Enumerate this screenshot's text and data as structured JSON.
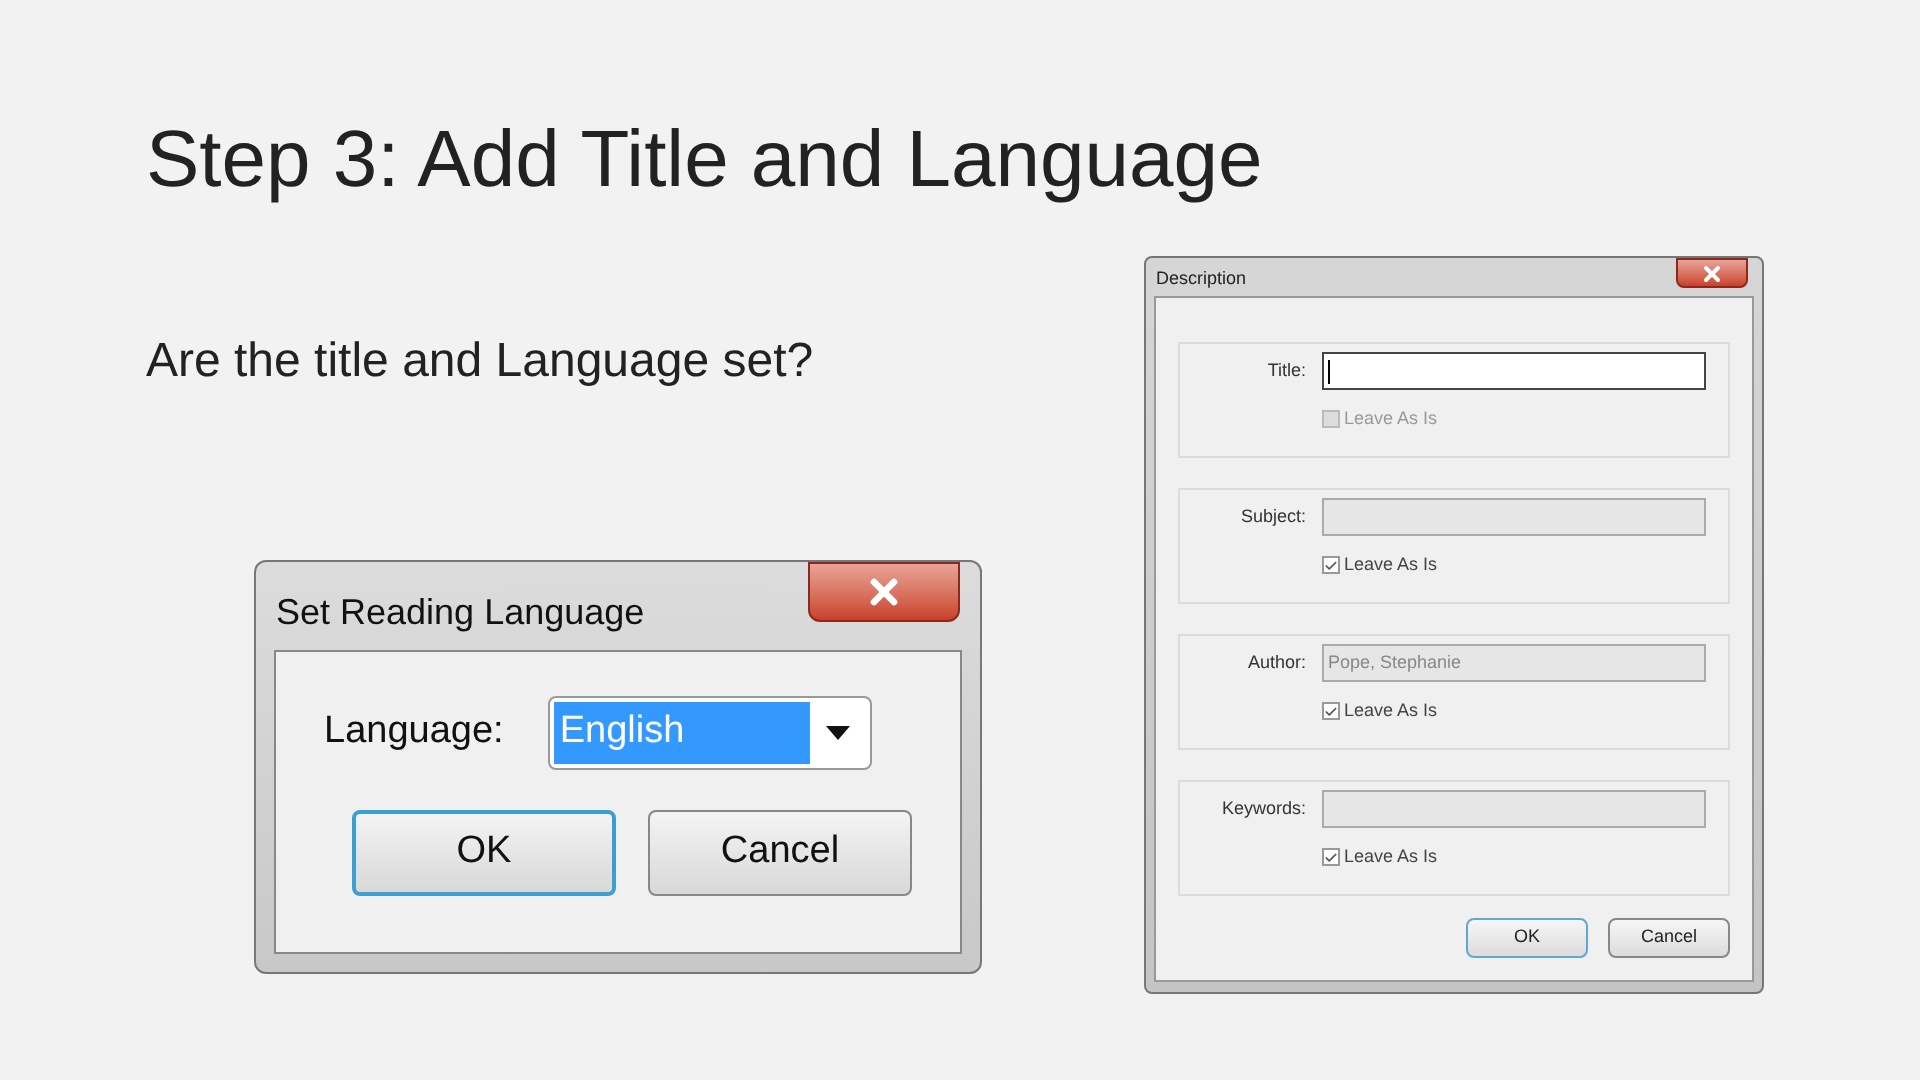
{
  "slide": {
    "title": "Step 3: Add Title and Language",
    "subtitle": "Are the title and Language set?"
  },
  "language_dialog": {
    "title": "Set Reading Language",
    "label": "Language:",
    "dropdown": {
      "value": "English",
      "selected": true
    },
    "buttons": [
      {
        "label": "OK",
        "default": true
      },
      {
        "label": "Cancel",
        "default": false
      }
    ]
  },
  "description_dialog": {
    "title": "Description",
    "fields": [
      {
        "label": "Title:",
        "focused": true,
        "disabled": false,
        "checkbox": {
          "label": "Leave As Is",
          "checked": false,
          "disabled": true
        }
      },
      {
        "label": "Subject:",
        "focused": false,
        "disabled": true,
        "checkbox": {
          "label": "Leave As Is",
          "checked": true,
          "disabled": false
        }
      },
      {
        "label": "Author:",
        "value": "Pope, Stephanie",
        "focused": false,
        "disabled": true,
        "checkbox": {
          "label": "Leave As Is",
          "checked": true,
          "disabled": false
        }
      },
      {
        "label": "Keywords:",
        "focused": false,
        "disabled": true,
        "checkbox": {
          "label": "Leave As Is",
          "checked": true,
          "disabled": false
        }
      }
    ],
    "buttons": [
      {
        "label": "OK",
        "default": true
      },
      {
        "label": "Cancel",
        "default": false
      }
    ]
  }
}
